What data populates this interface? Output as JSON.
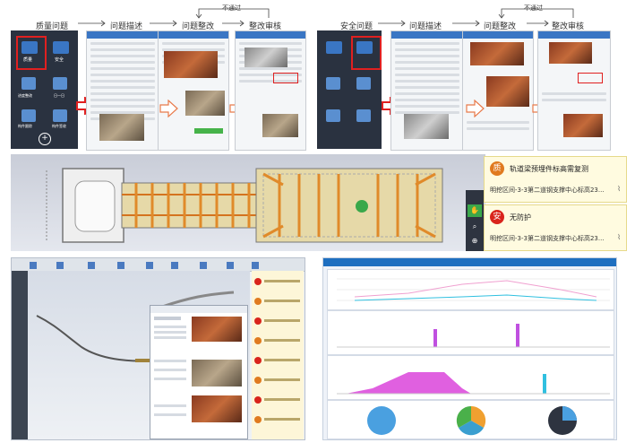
{
  "top_flow": {
    "left": {
      "steps": [
        "质量问题",
        "问题描述",
        "问题整改",
        "整改审核"
      ],
      "feedback_label": "不通过"
    },
    "right": {
      "steps": [
        "安全问题",
        "问题描述",
        "问题整改",
        "整改审核"
      ],
      "feedback_label": "不通过"
    }
  },
  "app_menu": {
    "items": [
      "质量",
      "安全",
      "进度整改",
      "日一日",
      "构件跟踪",
      "构件签收"
    ]
  },
  "notices": [
    {
      "badge": "质",
      "badge_color": "#e07a1f",
      "title": "轨道梁预埋件标高需复测",
      "subtitle": "明挖区间-3-3第二道钢支撑中心标高23..."
    },
    {
      "badge": "安",
      "badge_color": "#d9241c",
      "title": "无防护",
      "subtitle": "明挖区间-3-3第二道钢支撑中心标高23..."
    }
  ],
  "colors": {
    "blue_bar": "#3a76c4",
    "orange_beam": "#e08a2a",
    "red_highlight": "#e02020",
    "green_marker": "#3aa84a",
    "pink_series": "#e060e0",
    "cyan_series": "#30c0e0"
  },
  "icons": [
    "hand-icon",
    "search-icon",
    "zoom-icon",
    "clip-icon"
  ]
}
